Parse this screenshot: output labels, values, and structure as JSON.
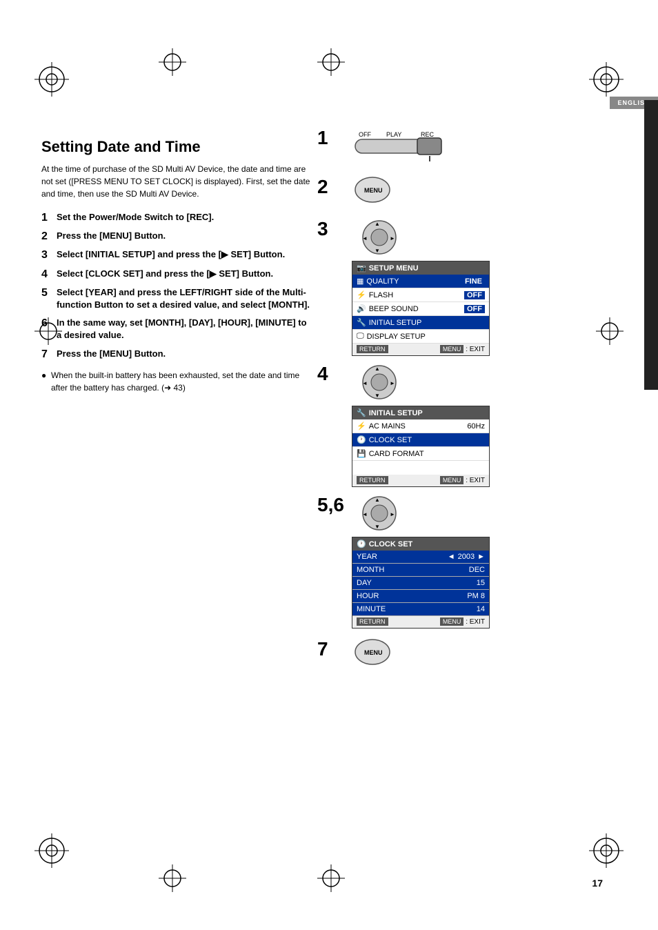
{
  "page": {
    "number": "17",
    "language_tab": "ENGLISH"
  },
  "title": "Setting Date and Time",
  "intro": "At the time of purchase of the SD Multi AV Device, the date and time are not set ([PRESS MENU TO SET CLOCK] is displayed). First, set the date and time, then use the SD Multi AV Device.",
  "steps": [
    {
      "num": "1",
      "text": "Set the Power/Mode Switch to [REC]."
    },
    {
      "num": "2",
      "text": "Press the [MENU] Button."
    },
    {
      "num": "3",
      "text": "Select [INITIAL SETUP] and press the [▶ SET] Button."
    },
    {
      "num": "4",
      "text": "Select [CLOCK SET] and press the [▶ SET] Button."
    },
    {
      "num": "5",
      "text": "Select [YEAR] and press the LEFT/RIGHT side of the Multi-function Button to set a desired value, and select [MONTH]."
    },
    {
      "num": "6",
      "text": "In the same way, set [MONTH], [DAY], [HOUR], [MINUTE] to a desired value."
    },
    {
      "num": "7",
      "text": "Press the [MENU] Button."
    }
  ],
  "note": "When the built-in battery has been exhausted, set the date and time after the battery has charged. (➜ 43)",
  "setup_menu": {
    "header": "SETUP MENU",
    "rows": [
      {
        "label": "QUALITY",
        "value": "FINE",
        "highlighted": true
      },
      {
        "label": "FLASH",
        "value": "OFF",
        "highlighted": false
      },
      {
        "label": "BEEP SOUND",
        "value": "OFF",
        "highlighted": false
      },
      {
        "label": "INITIAL SETUP",
        "value": "",
        "highlighted": true
      },
      {
        "label": "DISPLAY SETUP",
        "value": "",
        "highlighted": false
      }
    ],
    "footer_btn": "MENU",
    "footer_label": "EXIT"
  },
  "initial_setup_menu": {
    "header": "INITIAL SETUP",
    "rows": [
      {
        "label": "AC MAINS",
        "value": "60Hz",
        "highlighted": false
      },
      {
        "label": "CLOCK SET",
        "value": "",
        "highlighted": true
      },
      {
        "label": "CARD FORMAT",
        "value": "",
        "highlighted": false
      }
    ],
    "footer_btn": "MENU",
    "footer_label": "EXIT"
  },
  "clock_set_menu": {
    "header": "CLOCK SET",
    "rows": [
      {
        "label": "YEAR",
        "value": "2003",
        "highlighted": true,
        "has_arrows": true
      },
      {
        "label": "MONTH",
        "value": "DEC",
        "highlighted": false
      },
      {
        "label": "DAY",
        "value": "15",
        "highlighted": false
      },
      {
        "label": "HOUR",
        "value": "PM 8",
        "highlighted": false
      },
      {
        "label": "MINUTE",
        "value": "14",
        "highlighted": false
      }
    ],
    "footer_btn": "MENU",
    "footer_label": "EXIT"
  },
  "switch_labels": {
    "off": "OFF",
    "play": "PLAY",
    "rec": "REC"
  },
  "return_label": "RETURN"
}
